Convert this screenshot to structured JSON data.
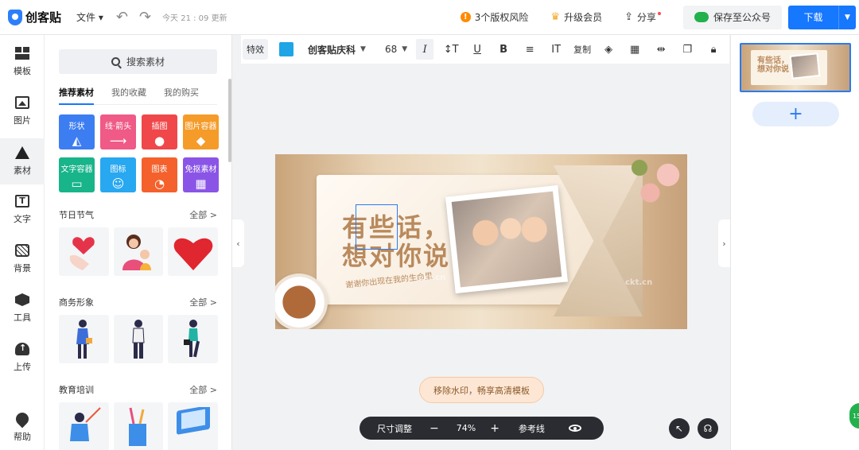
{
  "app": {
    "name": "创客贴"
  },
  "topbar": {
    "file_menu": "文件 ▾",
    "saved_text": "今天 21 : 09 更新",
    "copyright_risk": "3个版权风险",
    "upgrade": "升级会员",
    "share": "分享",
    "save_wechat": "保存至公众号",
    "download": "下载"
  },
  "rail": {
    "items": [
      {
        "label": "模板",
        "icon": "template-icon"
      },
      {
        "label": "图片",
        "icon": "image-icon"
      },
      {
        "label": "素材",
        "icon": "material-icon",
        "active": true
      },
      {
        "label": "文字",
        "icon": "text-icon"
      },
      {
        "label": "背景",
        "icon": "background-icon"
      },
      {
        "label": "工具",
        "icon": "tool-icon"
      },
      {
        "label": "上传",
        "icon": "upload-icon"
      },
      {
        "label": "帮助",
        "icon": "help-icon"
      }
    ]
  },
  "panel": {
    "search_label": "搜索素材",
    "tabs": [
      "推荐素材",
      "我的收藏",
      "我的购买"
    ],
    "categories": [
      {
        "label": "形状",
        "color": "#3d7df2"
      },
      {
        "label": "线·箭头",
        "color": "#ef5a86"
      },
      {
        "label": "插图",
        "color": "#f0474a"
      },
      {
        "label": "图片容器",
        "color": "#f59b29"
      },
      {
        "label": "文字容器",
        "color": "#18b48a"
      },
      {
        "label": "图标",
        "color": "#28a8f0"
      },
      {
        "label": "图表",
        "color": "#f4612c"
      },
      {
        "label": "免抠素材",
        "color": "#8a55e6"
      }
    ],
    "sections": [
      {
        "title": "节日节气",
        "more": "全部 >"
      },
      {
        "title": "商务形象",
        "more": "全部 >"
      },
      {
        "title": "教育培训",
        "more": "全部 >"
      }
    ]
  },
  "toolbar": {
    "effect": "特效",
    "color": "#1fa4e6",
    "font": "创客贴庆科",
    "size": "68",
    "copy": "复制"
  },
  "canvas": {
    "headline_1": "有些话，",
    "headline_2": "想对你说",
    "subline": "谢谢你出现在我的生命里",
    "watermark": "ckt.cn"
  },
  "watermark_remove": "移除水印，畅享高清模板",
  "zoombar": {
    "size_adjust": "尺寸调整",
    "minus": "−",
    "zoom": "74%",
    "plus": "+",
    "guides": "参考线"
  },
  "pages": {
    "add": "+",
    "thumb_text_1": "有些话，",
    "thumb_text_2": "想对你说"
  },
  "float_badge": "15"
}
